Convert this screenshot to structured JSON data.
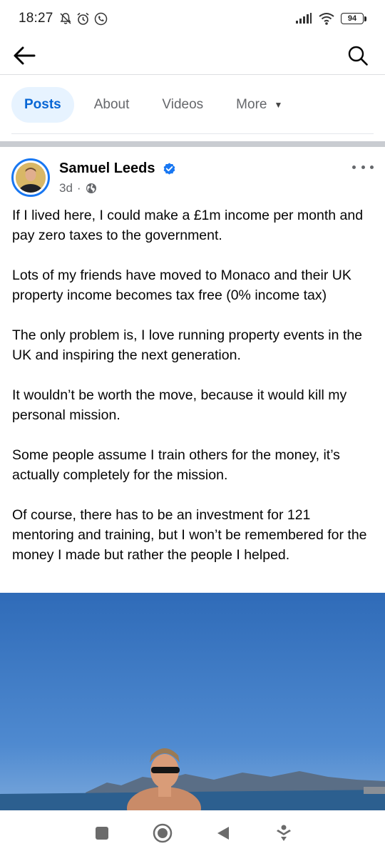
{
  "status_bar": {
    "time": "18:27",
    "battery": "94"
  },
  "top_nav": {
    "back_icon": "arrow-left-icon",
    "search_icon": "search-icon"
  },
  "tabs": [
    {
      "label": "Posts",
      "active": true
    },
    {
      "label": "About",
      "active": false
    },
    {
      "label": "Videos",
      "active": false
    },
    {
      "label": "More",
      "active": false
    }
  ],
  "post": {
    "author": "Samuel Leeds",
    "verified": true,
    "time": "3d",
    "separator": "·",
    "audience_icon": "globe-icon",
    "paragraphs": [
      "If I lived here, I could make a £1m income per month and pay zero taxes to the government.",
      "Lots of my friends have moved to Monaco and their UK property income becomes tax free (0% income tax)",
      "The only problem is, I love running property events in the UK and inspiring the next generation.",
      "It wouldn’t be worth the move, because it would kill my personal mission.",
      "Some people assume I train others for the money, it’s actually completely for the mission.",
      "Of course, there has to be an investment for 121 mentoring and training, but I won’t be remembered for the money I made but rather the people I helped."
    ]
  },
  "colors": {
    "accent": "#0866d4",
    "accent_bg": "#e7f3ff",
    "verified": "#1877f2",
    "secondary_text": "#65676b",
    "sky": "#3f7bc4"
  },
  "bottom_nav": [
    "square-icon",
    "home-circle-icon",
    "back-triangle-icon",
    "accessibility-icon"
  ]
}
